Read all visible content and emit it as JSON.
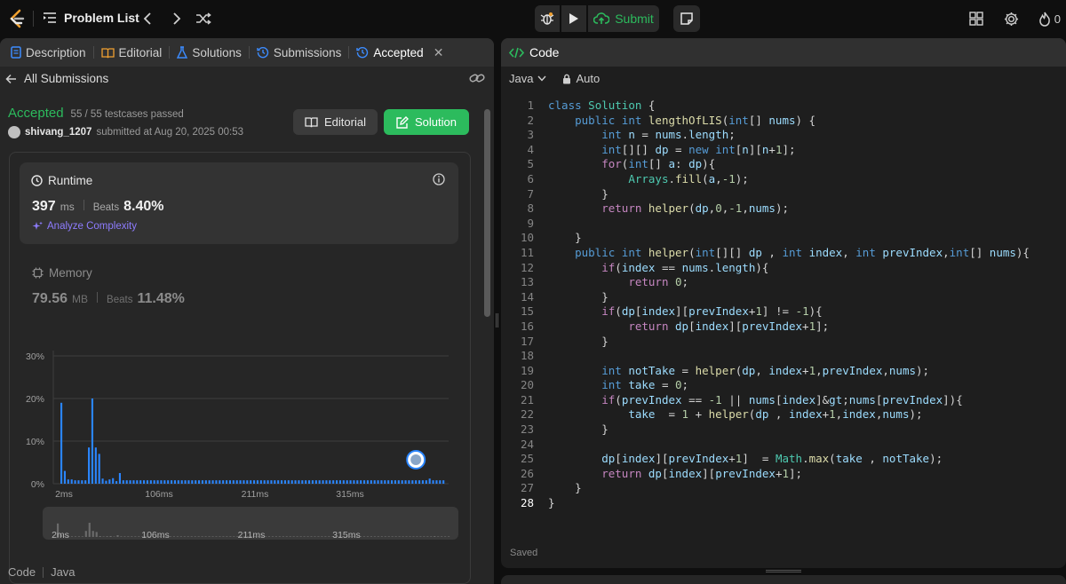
{
  "topbar": {
    "problem_list": "Problem List",
    "submit": "Submit",
    "streak": "0"
  },
  "left_tabs": [
    {
      "label": "Description",
      "icon": "document-icon"
    },
    {
      "label": "Editorial",
      "icon": "book-icon"
    },
    {
      "label": "Solutions",
      "icon": "flask-icon"
    },
    {
      "label": "Submissions",
      "icon": "history-icon"
    },
    {
      "label": "Accepted",
      "icon": "history-icon"
    }
  ],
  "submission": {
    "back_label": "All Submissions",
    "status": "Accepted",
    "testcases": "55 / 55 testcases passed",
    "username": "shivang_1207",
    "submitted_at": "submitted at Aug 20, 2025 00:53",
    "editorial_btn": "Editorial",
    "solution_btn": "Solution"
  },
  "runtime": {
    "label": "Runtime",
    "value": "397",
    "unit": "ms",
    "beats_label": "Beats",
    "beats": "8.40%",
    "analyze": "Analyze Complexity"
  },
  "memory": {
    "label": "Memory",
    "value": "79.56",
    "unit": "MB",
    "beats_label": "Beats",
    "beats": "11.48%"
  },
  "chart_data": {
    "type": "bar",
    "ylim": [
      0,
      30
    ],
    "yticks": [
      "30%",
      "20%",
      "10%",
      "0%"
    ],
    "xticks": [
      "2ms",
      "106ms",
      "211ms",
      "315ms"
    ],
    "values": [
      19,
      3,
      1,
      1,
      0.8,
      0.8,
      0.8,
      0.8,
      8.5,
      20,
      8.5,
      7,
      1.2,
      0.7,
      1,
      1.3,
      0.6,
      2.5,
      0.8,
      0.8,
      0.8,
      0.8,
      0.8,
      0.8,
      0.8,
      0.8,
      0.8,
      0.8,
      0.8,
      0.8,
      0.8,
      0.8,
      0.8,
      0.8,
      0.8,
      0.8,
      0.8,
      0.8,
      0.8,
      0.8,
      0.8,
      0.8,
      0.8,
      0.8,
      0.8,
      0.8,
      0.8,
      0.8,
      0.8,
      0.8,
      0.8,
      0.8,
      0.8,
      0.8,
      0.8,
      0.8,
      0.8,
      0.8,
      0.8,
      0.8,
      0.8,
      0.8,
      0.8,
      0.8,
      0.8,
      0.8,
      0.8,
      0.8,
      0.8,
      0.8,
      0.8,
      0.8,
      0.8,
      0.8,
      0.8,
      0.8,
      0.8,
      0.8,
      0.8,
      0.8,
      0.8,
      0.8,
      0.8,
      0.8,
      0.8,
      0.8,
      0.8,
      0.8,
      0.8,
      0.8,
      0.8,
      0.8,
      0.8,
      0.8,
      0.8,
      0.8,
      0.8,
      0.8,
      0.8,
      0.8,
      0.8,
      0.8,
      0.8,
      0.8,
      0.8,
      0.8,
      0.8,
      1.2,
      0.8,
      0.8,
      0.8,
      0.8
    ],
    "marker_index": 103,
    "bar_color": "#2a85ff",
    "grid": true
  },
  "bottom": {
    "code_label": "Code",
    "lang": "Java"
  },
  "editor": {
    "tab": "Code",
    "language": "Java",
    "mode": "Auto",
    "saved": "Saved",
    "lines": [
      "class Solution {",
      "    public int lengthOfLIS(int[] nums) {",
      "        int n = nums.length;",
      "        int[][] dp = new int[n][n+1];",
      "        for(int[] a: dp){",
      "            Arrays.fill(a,-1);",
      "        }",
      "        return helper(dp,0,-1,nums);",
      "",
      "    }",
      "    public int helper(int[][] dp , int index, int prevIndex,int[] nums){",
      "        if(index == nums.length){",
      "            return 0;",
      "        }",
      "        if(dp[index][prevIndex+1] != -1){",
      "            return dp[index][prevIndex+1];",
      "        }",
      "",
      "        int notTake = helper(dp, index+1,prevIndex,nums);",
      "        int take = 0;",
      "        if(prevIndex == -1 || nums[index]>nums[prevIndex]){",
      "            take  = 1 + helper(dp , index+1,index,nums);",
      "        }",
      "",
      "        dp[index][prevIndex+1]  = Math.max(take , notTake);",
      "        return dp[index][prevIndex+1];",
      "    }",
      "}"
    ]
  },
  "colors": {
    "accent_green": "#2cbb5d",
    "bar_blue": "#2a85ff",
    "analyze_purple": "#8e7cff"
  }
}
